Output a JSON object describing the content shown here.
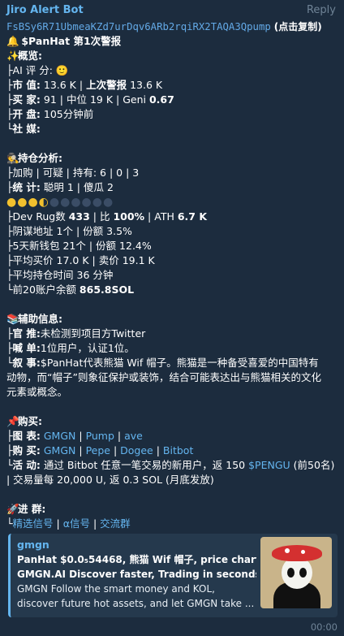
{
  "message": {
    "sender": "Jiro Alert Bot",
    "reply_label": "Reply",
    "address": "FsBSy6R71UbmeaKZd7urDqv6ARb2rqiRX2TAQA3Qpump",
    "copy_hint": "(点击复制)",
    "time": "00:00"
  },
  "title_line": {
    "emoji": "🔔",
    "ticker": "$PanHat",
    "text": "第1次警报"
  },
  "overview": {
    "header": "概览:",
    "ai_score_label": "AI 评 分:",
    "ai_score_emoji": "🙂",
    "market_cap_label": "市 值:",
    "market_cap": "13.6 K",
    "last_alert_label": "上次警报",
    "last_alert": "13.6 K",
    "buyers_label": "买 家:",
    "buyers": "91",
    "median_label": "中位",
    "median": "19 K",
    "geni_label": "Geni",
    "geni": "0.67",
    "open_label": "开 盘:",
    "open": "105分钟前",
    "social_label": "社 媒:"
  },
  "holdings": {
    "header": "持仓分析:",
    "row1": "加购 | 可疑 | 持有: 6 | 0 | 3",
    "row2_label": "统 计:",
    "smart_label": "聪明",
    "smart": "1",
    "dumb_label": "傻瓜",
    "dumb": "2",
    "coin_filled": 3,
    "coin_half": 1,
    "coin_total": 10,
    "dev_label": "Dev Rug数",
    "dev_count": "433",
    "ratio_label": "比",
    "ratio": "100%",
    "ath_label": "ATH",
    "ath": "6.7 K",
    "bundle_label": "阴谋地址",
    "bundle_count": "1个",
    "bundle_share_label": "份额",
    "bundle_share": "3.5%",
    "new_wallet_label": "5天新钱包",
    "new_wallet_count": "21个",
    "new_wallet_share_label": "份额",
    "new_wallet_share": "12.4%",
    "avg_buy_label": "平均买价",
    "avg_buy": "17.0 K",
    "avg_sell_label": "卖价",
    "avg_sell": "19.1 K",
    "avg_hold_label": "平均持仓时间",
    "avg_hold": "36 分钟",
    "top20_label": "前20账户余额",
    "top20": "865.8SOL"
  },
  "aux": {
    "header": "辅助信息:",
    "official_label": "官 推:",
    "official": "未检测到项目方Twitter",
    "shout_label": "喊 单:",
    "shout": "1位用户，认证1位。",
    "story_label": "叙 事:",
    "story_line1": "$PanHat代表熊猫 Wif 帽子。熊猫是一种备受喜爱的中国特有",
    "story_line2": "动物，而“帽子”则象征保护或装饰，结合可能表达出与熊猫相关的文化",
    "story_line3": "元素或概念。"
  },
  "buy": {
    "header": "购买:",
    "chart_label": "图 表:",
    "chart_links": [
      "GMGN",
      "Pump",
      "ave"
    ],
    "buy_label": "购 买:",
    "buy_links": [
      "GMGN",
      "Pepe",
      "Dogee",
      "Bitbot"
    ],
    "promo_label": "活 动:",
    "promo_text1": "通过 Bitbot 任意一笔交易的新用户，返",
    "promo_amount": "150",
    "promo_token": "$PENGU",
    "promo_text2": "(前50名)",
    "promo_line2": "| 交易量每 20,000 U, 返 0.3 SOL (月底发放)"
  },
  "groups": {
    "header": "进 群:",
    "links": [
      "精选信号",
      "α信号",
      "交流群"
    ]
  },
  "preview": {
    "site": "gmgn",
    "title_line1": "PanHat $0.0₅54468, 熊猫 Wif 帽子, price chart -",
    "title_line2": "GMGN.AI Discover faster, Trading in seconds....",
    "desc_line1": "GMGN Follow the smart money and KOL,",
    "desc_line2": "discover future hot assets, and let GMGN take ..."
  }
}
